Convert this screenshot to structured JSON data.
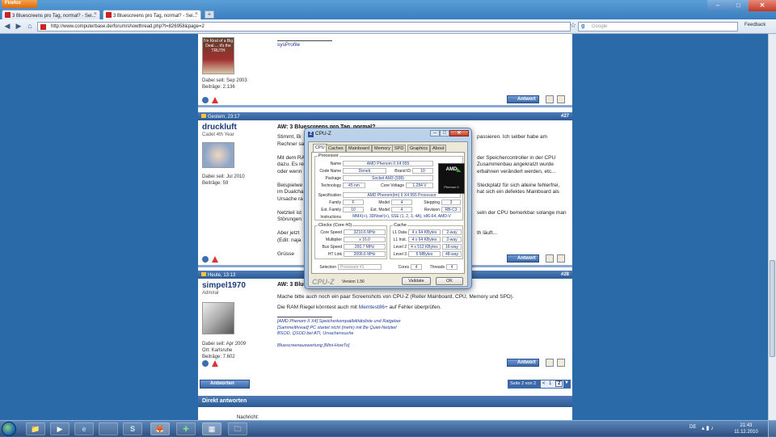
{
  "browser": {
    "menu_label": "Firefox",
    "tabs": [
      {
        "label": "3 Bluescreens pro Tag, normal? - Sei..."
      },
      {
        "label": "3 Bluescreens pro Tag, normal? - Sei..."
      }
    ],
    "new_tab": "+",
    "url": "http://www.computerbase.de/forum/showthread.php?t=826958&page=2",
    "search_placeholder": "Google",
    "search_engine_icon": "g",
    "feedback_label": "Feedback",
    "window_buttons": {
      "min": "–",
      "max": "□",
      "close": "✕"
    }
  },
  "posts": [
    {
      "avatar_text": "I'm Kind of a Big Deal ... it's the TRUTH",
      "joined": "Dabei seit: Sep 2003",
      "posts_count": "Beiträge: 2.136",
      "sig": "sysProfile",
      "reply_label": "Antwort"
    },
    {
      "date": "Gestern, 23:17",
      "number": "#27",
      "username": "druckluft",
      "usertitle": "Cadet 4th Year",
      "joined": "Dabei seit: Jul 2010",
      "posts_count": "Beiträge: 59",
      "title": "AW: 3 Bluescreens pro Tag, normal?",
      "lines": [
        "Stimmt, Bi",
        "Rechner sa",
        "",
        "Mit dem RA",
        "dazu. Es re",
        "oder wenn",
        "",
        "Beispielwe",
        "im Dualcha",
        "Ursache ra",
        "",
        "Netzteil ist",
        "Störungen",
        "",
        "Aber jetzt",
        "(Edit: naja",
        "",
        "Grüsse"
      ],
      "right_lines": [
        "passieren. Ich selber habe am",
        "",
        "",
        "der Speichercontroller in der CPU",
        "Zusammenbau angekratzt wurde",
        "erbahnen verändert werden, etc...",
        "",
        "Steckplatz für sich alleine fehlerfrei,",
        "hat sich ein defektes Mainboard als",
        "",
        "",
        "seln der CPU bemerkbar solange man",
        "",
        "",
        "th läuft...",
        "",
        ""
      ],
      "reply_label": "Antwort"
    },
    {
      "date": "Heute, 13:13",
      "number": "#28",
      "username": "simpel1970",
      "usertitle": "Admiral",
      "joined": "Dabei seit: Apr 2009",
      "location": "Ort: Karlsruhe",
      "posts_count": "Beiträge: 7.602",
      "title": "AW: 3 Blue",
      "line1": "Mache bitte auch noch ein paar Screenshots von CPU-Z (Reiter Mainboard, CPU, Memory und SPD).",
      "line2_pre": "Die RAM Riegel könntest auch mit ",
      "line2_link": "Memtest86+",
      "line2_post": " auf Fehler überprüfen.",
      "sig_lines": [
        "[AMD Phenom II X4] Speicherkompatibilitätsliste und Ratgeber",
        "[Sammelthread] PC startet nicht (mehr) mit Be Quiet-Netzteil",
        "BSOD, QSOD bei ATI, Ursachensuche",
        "",
        "Bluescreenauswertung [Mini-HowTo]"
      ],
      "reply_label": "Antwort"
    }
  ],
  "pagination": {
    "reply_button": "Antworten",
    "page_label": "Seite 2 von 2",
    "prev": "<",
    "page1": "1",
    "page2": "2"
  },
  "quick_reply": {
    "title": "Direkt antworten",
    "field_label": "Nachricht:"
  },
  "cpuz": {
    "title": "CPU-Z",
    "tabs": [
      "CPU",
      "Caches",
      "Mainboard",
      "Memory",
      "SPD",
      "Graphics",
      "About"
    ],
    "processor_label": "Processor",
    "name_label": "Name",
    "name": "AMD Phenom II X4 955",
    "codename_label": "Code Name",
    "codename": "Deneb",
    "brandid_label": "Brand ID",
    "brandid": "10",
    "package_label": "Package",
    "package": "Socket AM3 (938)",
    "tech_label": "Technology",
    "tech": "45 nm",
    "voltage_label": "Core Voltage",
    "voltage": "1.284 V",
    "spec_label": "Specification",
    "spec": "AMD Phenom(tm) II X4 955 Processor",
    "family_label": "Family",
    "family": "F",
    "model_label": "Model",
    "model": "4",
    "stepping_label": "Stepping",
    "stepping": "3",
    "extfam_label": "Ext. Family",
    "extfam": "10",
    "extmodel_label": "Ext. Model",
    "extmodel": "4",
    "revision_label": "Revision",
    "revision": "RB-C3",
    "instr_label": "Instructions",
    "instr": "MMX(+), 3DNow!(+), SSE (1, 2, 3, 4A), x86-64, AMD-V",
    "clocks_label": "Clocks (Core #0)",
    "corespeed_label": "Core Speed",
    "corespeed": "3210.6 MHz",
    "mult_label": "Multiplier",
    "mult": "x 16.0",
    "bus_label": "Bus Speed",
    "bus": "200.7 MHz",
    "ht_label": "HT Link",
    "ht": "2006.6 MHz",
    "cache_label": "Cache",
    "l1d_label": "L1 Data",
    "l1d": "4 x 64 KBytes",
    "l1d_way": "2-way",
    "l1i_label": "L1 Inst.",
    "l1i": "4 x 64 KBytes",
    "l1i_way": "2-way",
    "l2_label": "Level 2",
    "l2": "4 x 512 KBytes",
    "l2_way": "16-way",
    "l3_label": "Level 3",
    "l3": "6 MBytes",
    "l3_way": "48-way",
    "selection_label": "Selection",
    "selection": "Processor #1",
    "cores_label": "Cores",
    "cores": "4",
    "threads_label": "Threads",
    "threads": "4",
    "brand": "CPU-Z",
    "version": "Version 1.56",
    "validate": "Validate",
    "ok": "OK",
    "logo_text": "AMD",
    "logo_sub": "Phenom II"
  },
  "taskbar": {
    "items": [
      "📁",
      "▶",
      "e",
      "S",
      "🦊",
      "✚",
      "▦",
      "🗀"
    ],
    "lang": "DE",
    "time": "21:43",
    "date": "11.12.2010"
  }
}
